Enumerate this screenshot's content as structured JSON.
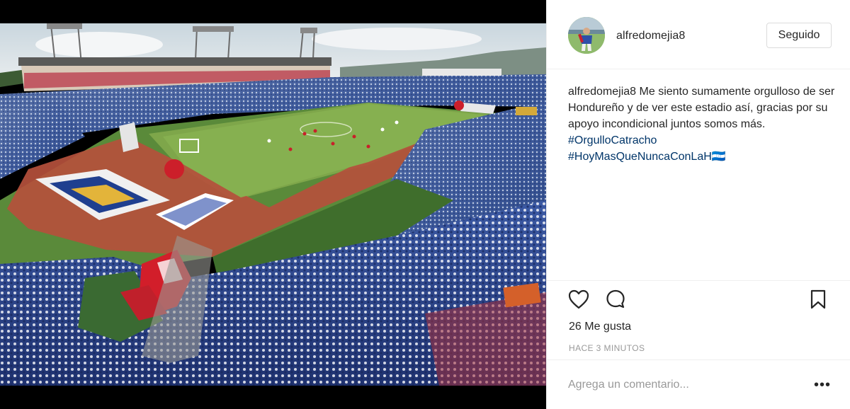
{
  "post": {
    "username": "alfredomejia8",
    "follow_label": "Seguido"
  },
  "caption": {
    "username": "alfredomejia8",
    "text": "Me siento sumamente orgulloso de ser Hondureño y de ver este estadio así, gracias por su apoyo incondicional juntos somos más.",
    "hashtags": [
      "#OrgulloCatracho",
      "#HoyMasQueNuncaConLaH🇭🇳"
    ]
  },
  "stats": {
    "likes": "26 Me gusta",
    "time_ago": "HACE 3 MINUTOS"
  },
  "comment": {
    "placeholder": "Agrega un comentario...",
    "more_label": "•••"
  },
  "photo": {
    "subject": "stadium-crowd"
  },
  "icons": {
    "like": "heart-icon",
    "comment": "comment-bubble-icon",
    "save": "bookmark-icon",
    "more": "ellipsis-icon"
  },
  "colors": {
    "hashtag": "#003569",
    "muted": "#999999",
    "border": "#efefef"
  }
}
